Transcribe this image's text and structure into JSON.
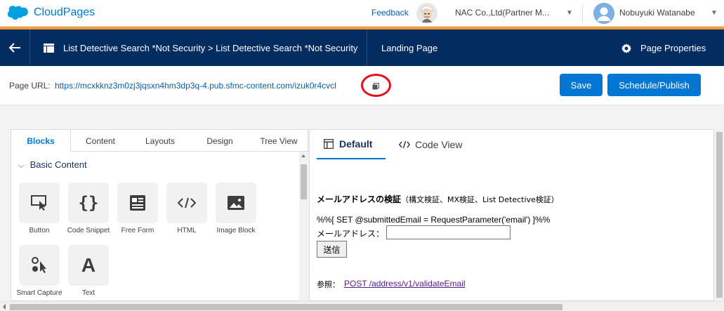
{
  "app": {
    "name": "CloudPages",
    "brand_color": "#0176d3",
    "logo_icon": "salesforce-cloud-logo"
  },
  "topbar": {
    "feedback_label": "Feedback",
    "org_name": "NAC Co.,Ltd(Partner M...",
    "user_name": "Nobuyuki Watanabe"
  },
  "nav": {
    "back_icon": "arrow-left-icon",
    "breadcrumb": "List Detective Search *Not Security > List Detective Search *Not Security",
    "page_type": "Landing Page",
    "properties_label": "Page Properties",
    "bg_color": "#032d60"
  },
  "urlbar": {
    "label": "Page URL:",
    "url": "https://mcxkknz3m0zj3jqsxn4hm3dp3q-4.pub.sfmc-content.com/izuk0r4cvcl",
    "save_label": "Save",
    "publish_label": "Schedule/Publish"
  },
  "left_panel": {
    "tabs": [
      "Blocks",
      "Content",
      "Layouts",
      "Design",
      "Tree View"
    ],
    "active_tab": "Blocks",
    "section_title": "Basic Content",
    "blocks": [
      {
        "label": "Button",
        "icon": "button-icon"
      },
      {
        "label": "Code Snippet",
        "icon": "code-snippet-icon"
      },
      {
        "label": "Free Form",
        "icon": "free-form-icon"
      },
      {
        "label": "HTML",
        "icon": "html-icon"
      },
      {
        "label": "Image Block",
        "icon": "image-icon"
      },
      {
        "label": "Smart Capture",
        "icon": "smart-capture-icon"
      },
      {
        "label": "Text",
        "icon": "text-icon"
      }
    ]
  },
  "right_panel": {
    "tabs": [
      {
        "label": "Default",
        "icon": "layout-icon",
        "active": true
      },
      {
        "label": "Code View",
        "icon": "code-icon",
        "active": false
      }
    ],
    "preview": {
      "heading": "メールアドレスの検証",
      "heading_note": "（構文検証、MX検証、List Detective検証）",
      "code_line": "%%[ SET @submittedEmail = RequestParameter('email') ]%%",
      "email_label": "メールアドレス：",
      "email_value": "",
      "submit_label": "送信",
      "ref_label": "参照：",
      "ref_link": "POST /address/v1/validateEmail"
    }
  }
}
